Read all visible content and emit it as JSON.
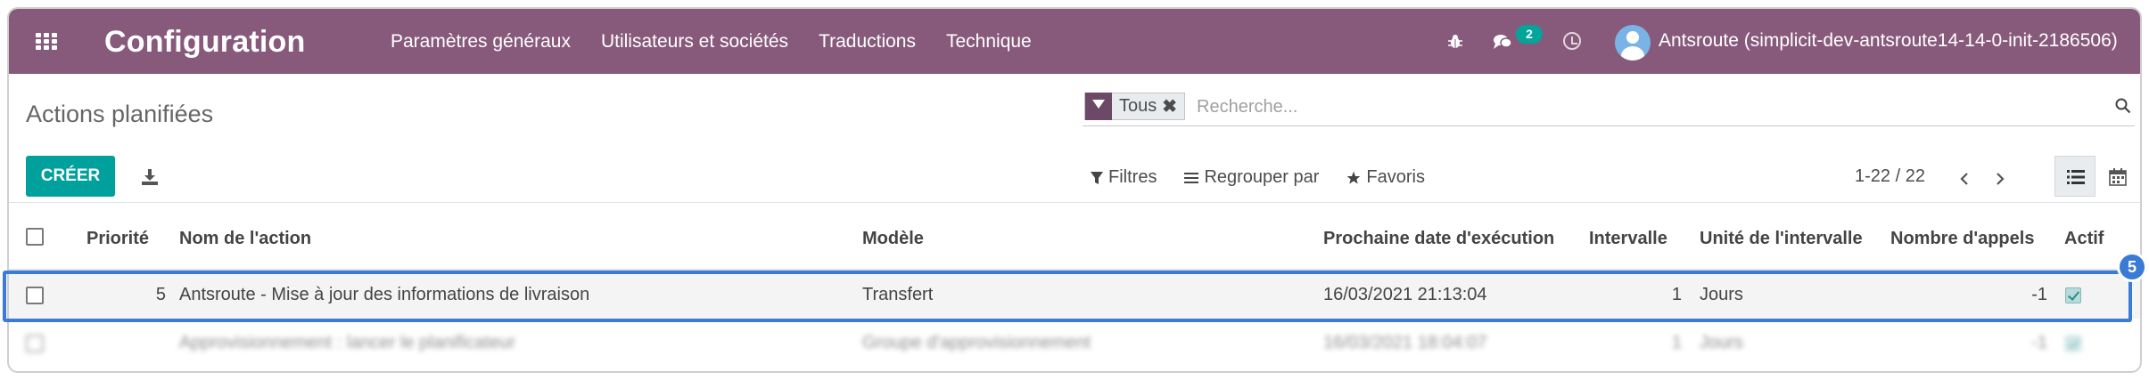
{
  "navbar": {
    "app_title": "Configuration",
    "menu": [
      "Paramètres généraux",
      "Utilisateurs et sociétés",
      "Traductions",
      "Technique"
    ],
    "messages_count": "2",
    "user": "Antsroute (simplicit-dev-antsroute14-14-0-init-2186506)",
    "accent": "#875a7b"
  },
  "control_panel": {
    "title": "Actions planifiées",
    "create_label": "CRÉER",
    "search": {
      "facet_label": "Tous",
      "placeholder": "Recherche..."
    },
    "filters_label": "Filtres",
    "groupby_label": "Regrouper par",
    "favorites_label": "Favoris",
    "pager": "1-22 / 22",
    "create_color": "#00a09d"
  },
  "table": {
    "columns": [
      "Priorité",
      "Nom de l'action",
      "Modèle",
      "Prochaine date d'exécution",
      "Intervalle",
      "Unité de l'intervalle",
      "Nombre d'appels",
      "Actif"
    ],
    "rows": [
      {
        "priority": "5",
        "name": "Antsroute - Mise à jour des informations de livraison",
        "model": "Transfert",
        "next_date": "16/03/2021 21:13:04",
        "interval": "1",
        "unit": "Jours",
        "calls": "-1",
        "active": true
      },
      {
        "priority": "",
        "name": "Approvisionnement : lancer le planificateur",
        "model": "Groupe d'approvisionnement",
        "next_date": "16/03/2021 18:04:07",
        "interval": "1",
        "unit": "Jours",
        "calls": "-1",
        "active": true
      }
    ]
  },
  "annotation": {
    "step": "5",
    "color": "#3a7bd5"
  }
}
